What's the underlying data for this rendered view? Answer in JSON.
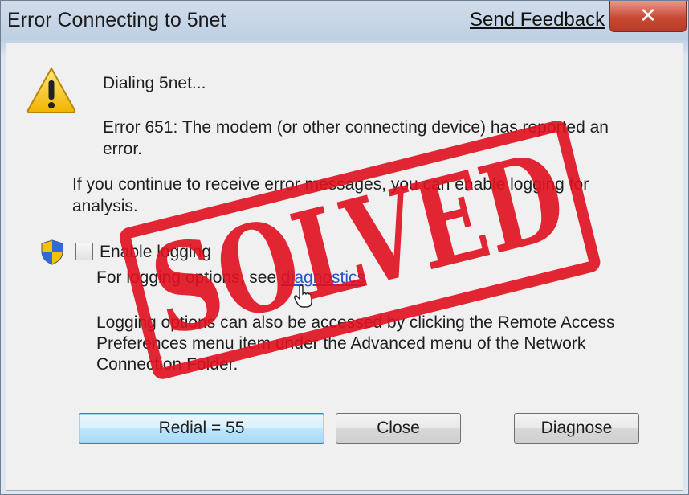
{
  "window": {
    "title": "Error Connecting to 5net",
    "feedback_link": "Send Feedback",
    "close_glyph": "✕"
  },
  "content": {
    "dialing": "Dialing 5net...",
    "error_line1": "Error 651: The modem (or other connecting device) has reported an",
    "error_line2": "error.",
    "continue_line1": "If you continue to receive error messages, you can enable logging for",
    "continue_line2": "analysis.",
    "enable_logging_label": "Enable logging",
    "logging_options_prefix": "For logging options, see",
    "diagnostics_link": "diagnostics",
    "logging_line1": "Logging options can also be accessed by clicking the Remote Access",
    "logging_line2": "Preferences menu item under the Advanced menu of the Network",
    "logging_line3": "Connection Folder.",
    "enable_logging_checked": false
  },
  "buttons": {
    "redial": "Redial = 55",
    "close": "Close",
    "diagnose": "Diagnose"
  },
  "overlay": {
    "stamp_text": "SOLVED",
    "stamp_color": "#e0101e"
  },
  "icons": {
    "warning": "warning-triangle-icon",
    "shield": "uac-shield-icon",
    "cursor": "hand-cursor-icon"
  },
  "colors": {
    "link": "#2a55c8",
    "close_button": "#c84a35",
    "default_button_border": "#3c7fb1"
  }
}
